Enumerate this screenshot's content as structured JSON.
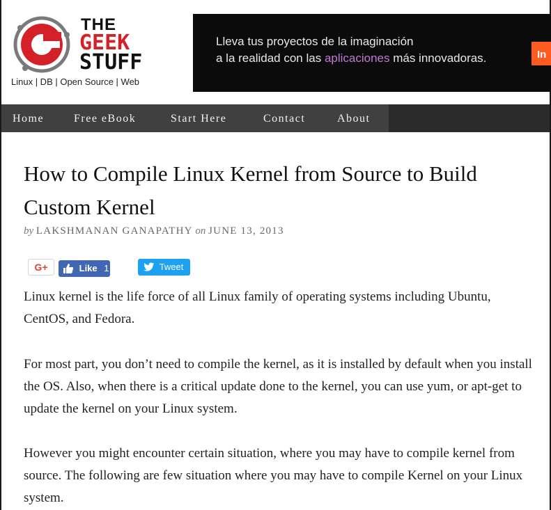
{
  "logo": {
    "the": "THE",
    "geek": "GEEK",
    "stuff": "STUFF",
    "tagline": "Linux | DB | Open Source | Web",
    "mark_letter": "G",
    "colors": {
      "red": "#d62027",
      "dark": "#111111"
    }
  },
  "ad": {
    "line1": "Lleva tus proyectos de la imaginación",
    "line2_a": "a la realidad con las ",
    "line2_highlight": "aplicaciones",
    "line2_b": " más innovadoras.",
    "cta": "In"
  },
  "nav": {
    "items": [
      {
        "label": "Home"
      },
      {
        "label": "Free eBook"
      },
      {
        "label": "Start Here"
      },
      {
        "label": "Contact"
      },
      {
        "label": "About"
      }
    ]
  },
  "article": {
    "title": "How to Compile Linux Kernel from Source to Build Custom Kernel",
    "by": "by",
    "author": "LAKSHMANAN GANAPATHY",
    "on": "on",
    "date": "JUNE 13, 2013",
    "paragraphs": [
      "Linux kernel is the life force of all Linux family of operating systems including Ubuntu, CentOS, and Fedora.",
      "For most part, you don’t need to compile the kernel, as it is installed by default when you install the OS. Also, when there is a critical update done to the kernel, you can use yum, or apt-get to update the kernel on your Linux system.",
      "However you might encounter certain situation, where you may have to compile kernel from source. The following are few situation where you may have to compile Kernel on your Linux system."
    ]
  },
  "social": {
    "gplus": "G+",
    "like_label": "Like",
    "like_count": "1",
    "tweet_label": "Tweet",
    "colors": {
      "facebook": "#4267b2",
      "twitter": "#1da1f2",
      "gplus": "#db4437"
    }
  }
}
